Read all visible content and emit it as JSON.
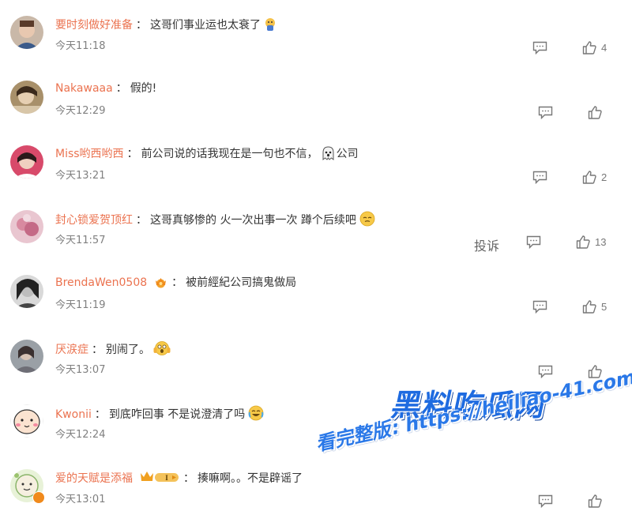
{
  "comments": [
    {
      "user": "要时刻做好准备",
      "text": "这哥们事业运也太衰了",
      "time": "今天11:18",
      "likes": "4",
      "emoji": "face-palm"
    },
    {
      "user": "Nakawaaa",
      "text": "假的!",
      "time": "今天12:29",
      "likes": ""
    },
    {
      "user": "Miss哟西哟西",
      "text": "前公司说的话我现在是一句也不信，",
      "text_after": "公司",
      "time": "今天13:21",
      "likes": "2",
      "emoji": "ghost"
    },
    {
      "user": "封心锁爱贺顶红",
      "text": "这哥真够惨的 火一次出事一次 蹲个后续吧",
      "time": "今天11:57",
      "likes": "13",
      "report": "投诉",
      "emoji": "sleepy"
    },
    {
      "user": "BrendaWen0508",
      "text": "被前經紀公司搞鬼做局",
      "time": "今天11:19",
      "likes": "5",
      "badge": "crown"
    },
    {
      "user": "厌涙症",
      "text": "别闹了。",
      "time": "今天13:07",
      "likes": "",
      "emoji": "scared"
    },
    {
      "user": "Kwonii",
      "text": "到底咋回事 不是说澄清了吗",
      "time": "今天12:24",
      "likes": "",
      "emoji": "laugh-cry"
    },
    {
      "user": "爱的天赋是添福",
      "text": "揍嘛啊。。不是辟谣了",
      "time": "今天13:01",
      "likes": "",
      "badge": "vip-crown",
      "badge_text": "I"
    }
  ],
  "watermark": {
    "title": "黑料吃瓜网",
    "subtitle": "看完整版: https://heiliao-41.com"
  },
  "colors": {
    "username": "#eb7350",
    "text": "#333333",
    "meta": "#808080",
    "watermark": "#1e6be0"
  }
}
